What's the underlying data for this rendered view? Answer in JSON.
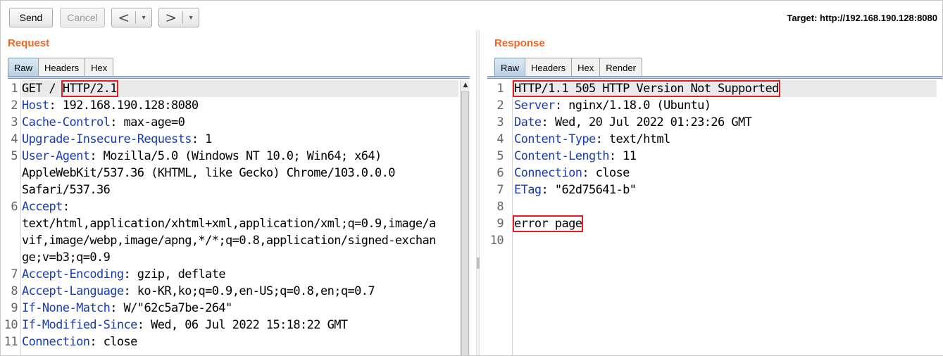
{
  "toolbar": {
    "send_label": "Send",
    "cancel_label": "Cancel",
    "back_arrow": "<",
    "forward_arrow": ">",
    "dropdown_glyph": "▾",
    "target_text": "Target: http://192.168.190.128:8080"
  },
  "request": {
    "title": "Request",
    "tabs": [
      "Raw",
      "Headers",
      "Hex"
    ],
    "active_tab": "Raw",
    "line_numbers": [
      "1",
      "2",
      "3",
      "4",
      "5",
      "",
      "",
      "6",
      "",
      "",
      "",
      "7",
      "8",
      "9",
      "10",
      "11"
    ],
    "lines": [
      {
        "parts": [
          {
            "t": "GET / "
          },
          {
            "t": "HTTP/2.1",
            "boxed": true
          }
        ],
        "highlight": true
      },
      {
        "parts": [
          {
            "t": "Host",
            "h": true
          },
          {
            "t": ": 192.168.190.128:8080"
          }
        ]
      },
      {
        "parts": [
          {
            "t": "Cache-Control",
            "h": true
          },
          {
            "t": ": max-age=0"
          }
        ]
      },
      {
        "parts": [
          {
            "t": "Upgrade-Insecure-Requests",
            "h": true
          },
          {
            "t": ": 1"
          }
        ]
      },
      {
        "parts": [
          {
            "t": "User-Agent",
            "h": true
          },
          {
            "t": ": Mozilla/5.0 (Windows NT 10.0; Win64; x64)"
          }
        ]
      },
      {
        "parts": [
          {
            "t": "AppleWebKit/537.36 (KHTML, like Gecko) Chrome/103.0.0.0"
          }
        ]
      },
      {
        "parts": [
          {
            "t": "Safari/537.36"
          }
        ]
      },
      {
        "parts": [
          {
            "t": "Accept",
            "h": true
          },
          {
            "t": ":"
          }
        ]
      },
      {
        "parts": [
          {
            "t": "text/html,application/xhtml+xml,application/xml;q=0.9,image/a"
          }
        ]
      },
      {
        "parts": [
          {
            "t": "vif,image/webp,image/apng,*/*;q=0.8,application/signed-exchan"
          }
        ]
      },
      {
        "parts": [
          {
            "t": "ge;v=b3;q=0.9"
          }
        ]
      },
      {
        "parts": [
          {
            "t": "Accept-Encoding",
            "h": true
          },
          {
            "t": ": gzip, deflate"
          }
        ]
      },
      {
        "parts": [
          {
            "t": "Accept-Language",
            "h": true
          },
          {
            "t": ": ko-KR,ko;q=0.9,en-US;q=0.8,en;q=0.7"
          }
        ]
      },
      {
        "parts": [
          {
            "t": "If-None-Match",
            "h": true
          },
          {
            "t": ": W/\"62c5a7be-264\""
          }
        ]
      },
      {
        "parts": [
          {
            "t": "If-Modified-Since",
            "h": true
          },
          {
            "t": ": Wed, 06 Jul 2022 15:18:22 GMT"
          }
        ]
      },
      {
        "parts": [
          {
            "t": "Connection",
            "h": true
          },
          {
            "t": ": close"
          }
        ]
      }
    ]
  },
  "response": {
    "title": "Response",
    "tabs": [
      "Raw",
      "Headers",
      "Hex",
      "Render"
    ],
    "active_tab": "Raw",
    "line_numbers": [
      "1",
      "2",
      "3",
      "4",
      "5",
      "6",
      "7",
      "8",
      "9",
      "10"
    ],
    "lines": [
      {
        "parts": [
          {
            "t": "HTTP/1.1 505 HTTP Version Not Supported",
            "boxed": true
          }
        ],
        "highlight": true
      },
      {
        "parts": [
          {
            "t": "Server",
            "h": true
          },
          {
            "t": ": nginx/1.18.0 (Ubuntu)"
          }
        ]
      },
      {
        "parts": [
          {
            "t": "Date",
            "h": true
          },
          {
            "t": ": Wed, 20 Jul 2022 01:23:26 GMT"
          }
        ]
      },
      {
        "parts": [
          {
            "t": "Content-Type",
            "h": true
          },
          {
            "t": ": text/html"
          }
        ]
      },
      {
        "parts": [
          {
            "t": "Content-Length",
            "h": true
          },
          {
            "t": ": 11"
          }
        ]
      },
      {
        "parts": [
          {
            "t": "Connection",
            "h": true
          },
          {
            "t": ": close"
          }
        ]
      },
      {
        "parts": [
          {
            "t": "ETag",
            "h": true
          },
          {
            "t": ": \"62d75641-b\""
          }
        ]
      },
      {
        "parts": [
          {
            "t": ""
          }
        ]
      },
      {
        "parts": [
          {
            "t": "error page",
            "boxed": true
          }
        ]
      },
      {
        "parts": [
          {
            "t": ""
          }
        ]
      }
    ]
  },
  "colors": {
    "accent_title": "#f26522",
    "header_name": "#1a3cb0",
    "annotation_box": "#e02020"
  },
  "icons": [
    "chevron-left-icon",
    "chevron-right-icon",
    "dropdown-arrow-icon",
    "scroll-up-arrow-icon"
  ]
}
